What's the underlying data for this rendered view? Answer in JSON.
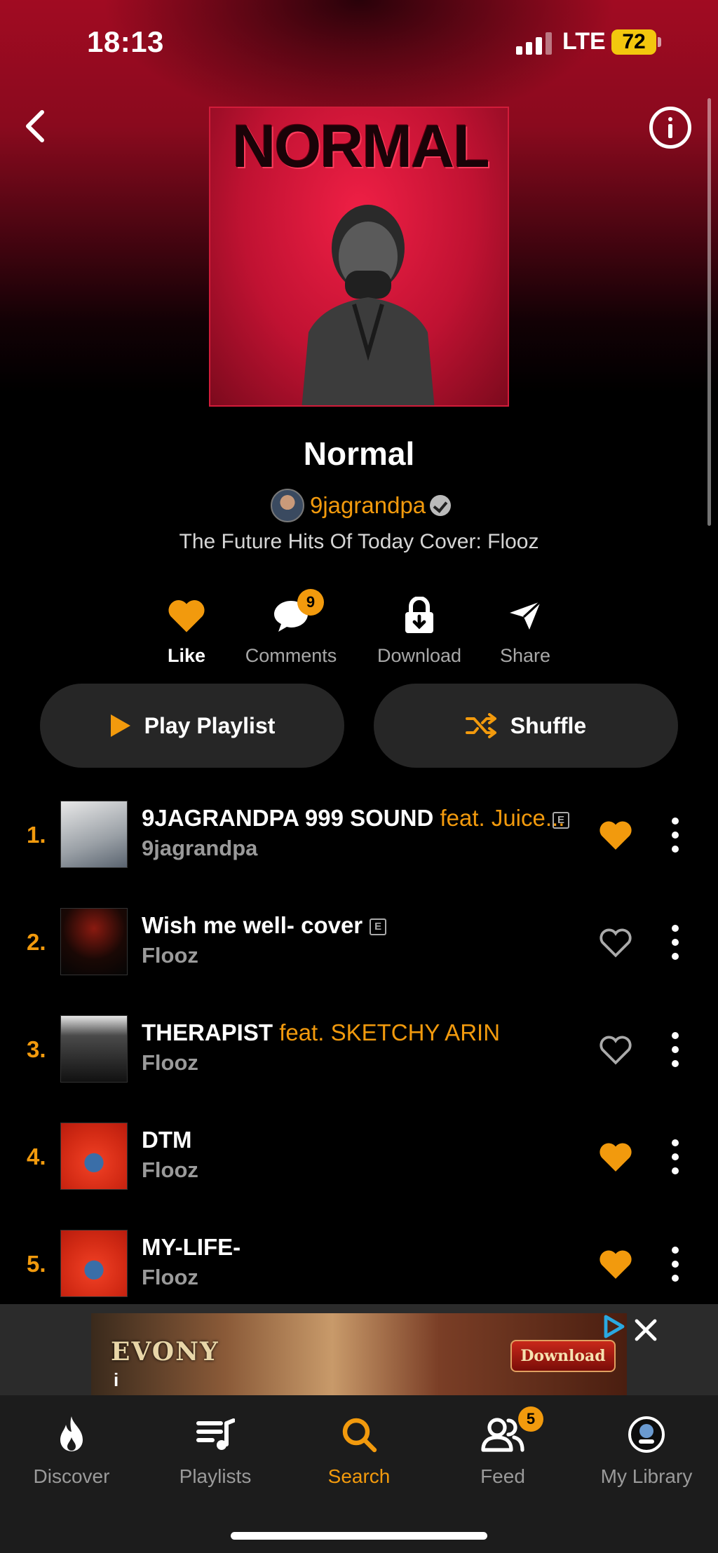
{
  "status_bar": {
    "time": "18:13",
    "network": "LTE",
    "battery": "72"
  },
  "header": {
    "back_icon": "chevron-left-icon",
    "info_icon": "info-icon"
  },
  "cover": {
    "title_text": "NORMAL"
  },
  "playlist": {
    "title": "Normal",
    "curator": "9jagrandpa",
    "description": "The Future Hits Of Today Cover: Flooz"
  },
  "actions": {
    "like": "Like",
    "comments": "Comments",
    "comments_count": "9",
    "download": "Download",
    "share": "Share"
  },
  "buttons": {
    "play": "Play Playlist",
    "shuffle": "Shuffle"
  },
  "tracks": [
    {
      "num": "1.",
      "title": "9JAGRANDPA 999 SOUND",
      "feat": "feat. Juice...",
      "explicit": "E",
      "artist": "9jagrandpa",
      "liked": true
    },
    {
      "num": "2.",
      "title": "Wish me well- cover",
      "feat": "",
      "explicit": "E",
      "artist": "Flooz",
      "liked": false
    },
    {
      "num": "3.",
      "title": "THERAPIST",
      "feat": "feat. SKETCHY ARIN",
      "explicit": "",
      "artist": "Flooz",
      "liked": false
    },
    {
      "num": "4.",
      "title": "DTM",
      "feat": "",
      "explicit": "",
      "artist": "Flooz",
      "liked": true
    },
    {
      "num": "5.",
      "title": "MY-LIFE-",
      "feat": "",
      "explicit": "",
      "artist": "Flooz",
      "liked": true
    }
  ],
  "ad": {
    "brand": "EVONY",
    "cta": "Download",
    "info": "i"
  },
  "nav": {
    "discover": "Discover",
    "playlists": "Playlists",
    "search": "Search",
    "feed": "Feed",
    "feed_badge": "5",
    "library": "My Library"
  },
  "colors": {
    "accent": "#f29a0d",
    "hero_red": "#a10b22",
    "background": "#000000"
  }
}
